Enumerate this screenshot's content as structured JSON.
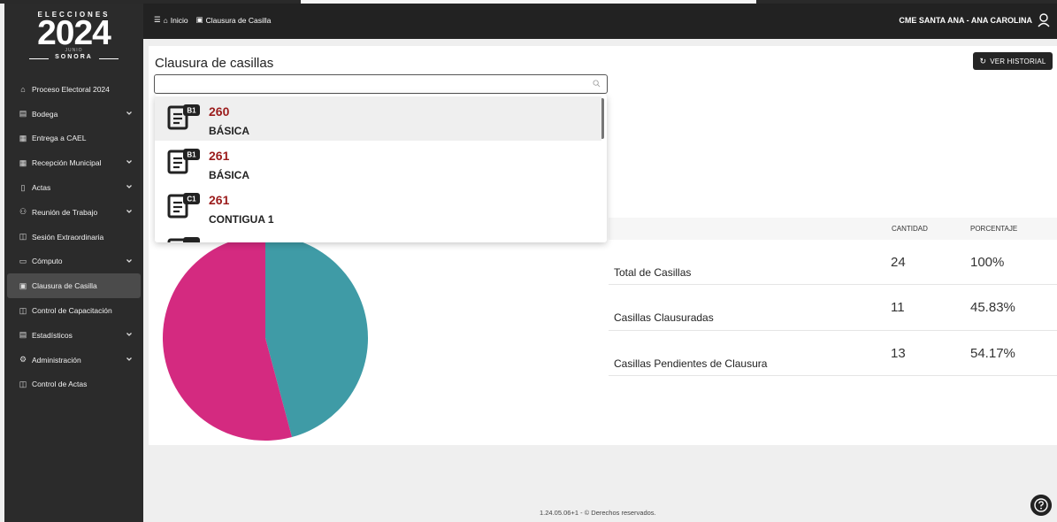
{
  "colors": {
    "sidebar": "#2b2b2b",
    "header": "#222222",
    "accent_red": "#9b1c1c",
    "pie_pink": "#d42a80",
    "pie_teal": "#3f9ba6"
  },
  "logo": {
    "line1": "ELECCIONES",
    "year": "2024",
    "month": "JUNIO",
    "state": "SONORA"
  },
  "sidebar": {
    "items": [
      {
        "label": "Proceso Electoral 2024",
        "icon": "home-icon",
        "glyph": "⌂",
        "chevron": false
      },
      {
        "label": "Bodega",
        "icon": "warehouse-icon",
        "glyph": "▤",
        "chevron": true
      },
      {
        "label": "Entrega a CAEL",
        "icon": "document-icon",
        "glyph": "▦",
        "chevron": false
      },
      {
        "label": "Recepción Municipal",
        "icon": "document-icon",
        "glyph": "▦",
        "chevron": true
      },
      {
        "label": "Actas",
        "icon": "file-icon",
        "glyph": "▯",
        "chevron": true
      },
      {
        "label": "Reunión de Trabajo",
        "icon": "team-icon",
        "glyph": "⚇",
        "chevron": true
      },
      {
        "label": "Sesión Extraordinaria",
        "icon": "desk-icon",
        "glyph": "◫",
        "chevron": false
      },
      {
        "label": "Cómputo",
        "icon": "laptop-icon",
        "glyph": "▭",
        "chevron": true
      },
      {
        "label": "Clausura de Casilla",
        "icon": "calendar-icon",
        "glyph": "▣",
        "chevron": false
      },
      {
        "label": "Control de Capacitación",
        "icon": "desk-icon",
        "glyph": "◫",
        "chevron": false
      },
      {
        "label": "Estadísticos",
        "icon": "chart-icon",
        "glyph": "▤",
        "chevron": true
      },
      {
        "label": "Administración",
        "icon": "gear-icon",
        "glyph": "⚙",
        "chevron": true
      },
      {
        "label": "Control de Actas",
        "icon": "desk-icon",
        "glyph": "◫",
        "chevron": false
      }
    ],
    "active_index": 8
  },
  "header": {
    "breadcrumb": {
      "home": "Inicio",
      "current": "Clausura de Casilla"
    },
    "user": "CME SANTA ANA - ANA CAROLINA"
  },
  "main": {
    "title": "Clausura de casillas",
    "history_button": "VER HISTORIAL",
    "search": {
      "value": "",
      "placeholder": ""
    }
  },
  "dropdown": {
    "items": [
      {
        "badge": "B1",
        "number": "260",
        "type": "BÁSICA"
      },
      {
        "badge": "B1",
        "number": "261",
        "type": "BÁSICA"
      },
      {
        "badge": "C1",
        "number": "261",
        "type": "CONTIGUA 1"
      }
    ],
    "highlighted_index": 0
  },
  "table": {
    "headers": {
      "quantity": "CANTIDAD",
      "percentage": "PORCENTAJE"
    },
    "rows": [
      {
        "label": "Total de Casillas",
        "quantity": "24",
        "percentage": "100%"
      },
      {
        "label": "Casillas Clausuradas",
        "quantity": "11",
        "percentage": "45.83%"
      },
      {
        "label": "Casillas Pendientes de Clausura",
        "quantity": "13",
        "percentage": "54.17%"
      }
    ]
  },
  "chart_data": {
    "type": "pie",
    "slices": [
      {
        "label": "Casillas Clausuradas",
        "value": 11,
        "color": "#3f9ba6"
      },
      {
        "label": "Casillas Pendientes de Clausura",
        "value": 13,
        "color": "#d42a80"
      }
    ]
  },
  "footer": {
    "text": "1.24.05.06+1 - © Derechos reservados."
  }
}
